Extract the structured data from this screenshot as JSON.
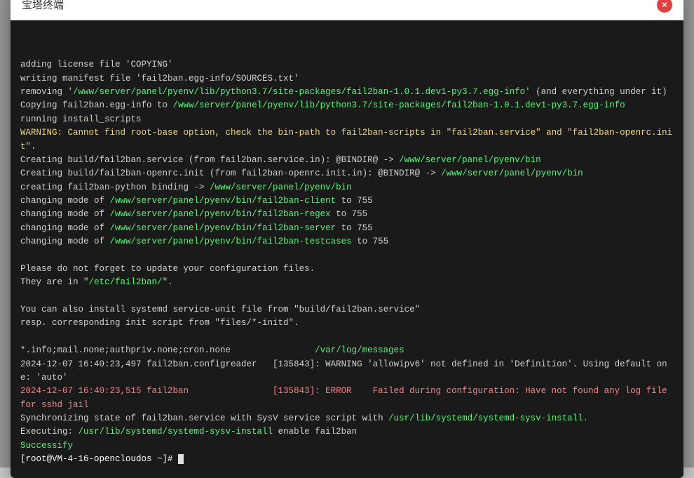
{
  "modal": {
    "title": "宝塔终端",
    "close_label": "×"
  },
  "terminal": {
    "lines": [
      {
        "text": "adding license file 'COPYING'",
        "type": "normal"
      },
      {
        "text": "writing manifest file 'fail2ban.egg-info/SOURCES.txt'",
        "type": "normal"
      },
      {
        "text": "removing '/www/server/panel/pyenv/lib/python3.7/site-packages/fail2ban-1.0.1.dev1-py3.7.egg-info' (and everything under it)",
        "type": "normal"
      },
      {
        "text": "Copying fail2ban.egg-info to /www/server/panel/pyenv/lib/python3.7/site-packages/fail2ban-1.0.1.dev1-py3.7.egg-info",
        "type": "normal"
      },
      {
        "text": "running install_scripts",
        "type": "normal"
      },
      {
        "text": "WARNING: Cannot find root-base option, check the bin-path to fail2ban-scripts in \"fail2ban.service\" and \"fail2ban-openrc.init\".",
        "type": "normal"
      },
      {
        "text": "Creating build/fail2ban.service (from fail2ban.service.in): @BINDIR@ -> /www/server/panel/pyenv/bin",
        "type": "normal"
      },
      {
        "text": "Creating build/fail2ban-openrc.init (from fail2ban-openrc.init.in): @BINDIR@ -> /www/server/panel/pyenv/bin",
        "type": "normal"
      },
      {
        "text": "creating fail2ban-python binding -> /www/server/panel/pyenv/bin",
        "type": "normal"
      },
      {
        "text": "changing mode of /www/server/panel/pyenv/bin/fail2ban-client to 755",
        "type": "normal"
      },
      {
        "text": "changing mode of /www/server/panel/pyenv/bin/fail2ban-regex to 755",
        "type": "normal"
      },
      {
        "text": "changing mode of /www/server/panel/pyenv/bin/fail2ban-server to 755",
        "type": "normal"
      },
      {
        "text": "changing mode of /www/server/panel/pyenv/bin/fail2ban-testcases to 755",
        "type": "normal"
      },
      {
        "text": "",
        "type": "normal"
      },
      {
        "text": "Please do not forget to update your configuration files.",
        "type": "normal"
      },
      {
        "text": "They are in \"/etc/fail2ban/\".",
        "type": "normal"
      },
      {
        "text": "",
        "type": "normal"
      },
      {
        "text": "You can also install systemd service-unit file from \"build/fail2ban.service\"",
        "type": "normal"
      },
      {
        "text": "resp. corresponding init script from \"files/*-initd\".",
        "type": "normal"
      },
      {
        "text": "",
        "type": "normal"
      },
      {
        "text": "*.info;mail.none;authpriv.none;cron.none                /var/log/messages",
        "type": "normal"
      },
      {
        "text": "2024-12-07 16:40:23,497 fail2ban.configreader   [135843]: WARNING 'allowipv6' not defined in 'Definition'. Using default one: 'auto'",
        "type": "normal"
      },
      {
        "text": "2024-12-07 16:40:23,515 fail2ban                [135843]: ERROR    Failed during configuration: Have not found any log file for sshd jail",
        "type": "normal"
      },
      {
        "text": "Synchronizing state of fail2ban.service with SysV service script with /usr/lib/systemd/systemd-sysv-install.",
        "type": "normal"
      },
      {
        "text": "Executing: /usr/lib/systemd/systemd-sysv-install enable fail2ban",
        "type": "normal"
      },
      {
        "text": "Successify",
        "type": "normal"
      },
      {
        "text": "[root@VM-4-16-opencloudos ~]# ",
        "type": "prompt"
      }
    ]
  }
}
